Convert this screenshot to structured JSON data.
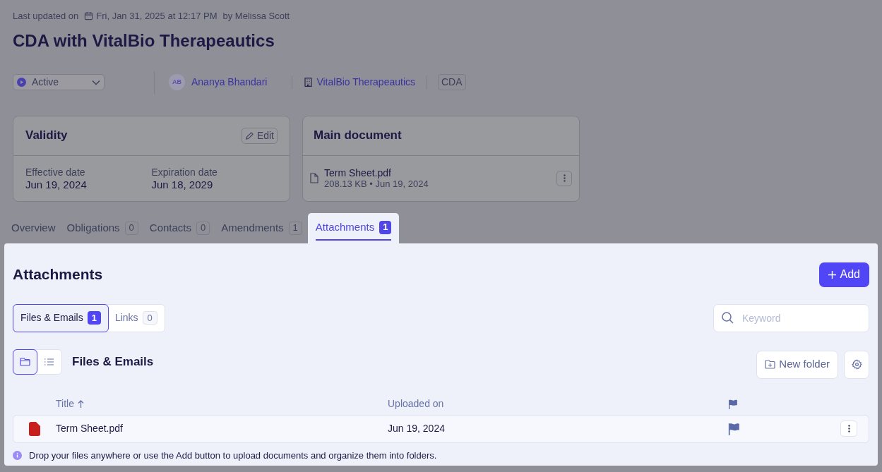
{
  "last_updated": {
    "label": "Last updated on",
    "date": "Fri, Jan 31, 2025 at 12:17 PM",
    "by": "by Melissa Scott"
  },
  "title": "CDA with VitalBio Therapeautics",
  "status": {
    "value": "Active"
  },
  "owner": {
    "initials": "AB",
    "name": "Ananya Bhandari"
  },
  "company": "VitalBio Therapeautics",
  "type_tag": "CDA",
  "validity": {
    "title": "Validity",
    "edit": "Edit",
    "fields": [
      {
        "label": "Effective date",
        "value": "Jun 19, 2024"
      },
      {
        "label": "Expiration date",
        "value": "Jun 18, 2029"
      }
    ]
  },
  "main_document": {
    "title": "Main document",
    "file": "Term Sheet.pdf",
    "meta": "208.13 KB • Jun 19, 2024"
  },
  "tabs": [
    {
      "label": "Overview",
      "selected": false
    },
    {
      "label": "Obligations",
      "count": "0",
      "selected": false
    },
    {
      "label": "Contacts",
      "count": "0",
      "selected": false
    },
    {
      "label": "Amendments",
      "count": "1",
      "selected": false
    },
    {
      "label": "Attachments",
      "count": "1",
      "selected": true
    }
  ],
  "attachments": {
    "title": "Attachments",
    "add": "Add",
    "subtabs": [
      {
        "label": "Files & Emails",
        "count": "1",
        "selected": true
      },
      {
        "label": "Links",
        "count": "0",
        "selected": false
      }
    ],
    "search": {
      "placeholder": "Keyword"
    },
    "views": [
      {
        "kind": "folder",
        "selected": true
      },
      {
        "kind": "list",
        "selected": false
      }
    ],
    "section_title": "Files & Emails",
    "new_folder": "New folder",
    "columns": [
      "Title",
      "Uploaded on"
    ],
    "rows": [
      {
        "title": "Term Sheet.pdf",
        "uploaded": "Jun 19, 2024"
      }
    ],
    "hint": "Drop your files anywhere or use the Add button to upload documents and organize them into folders."
  }
}
